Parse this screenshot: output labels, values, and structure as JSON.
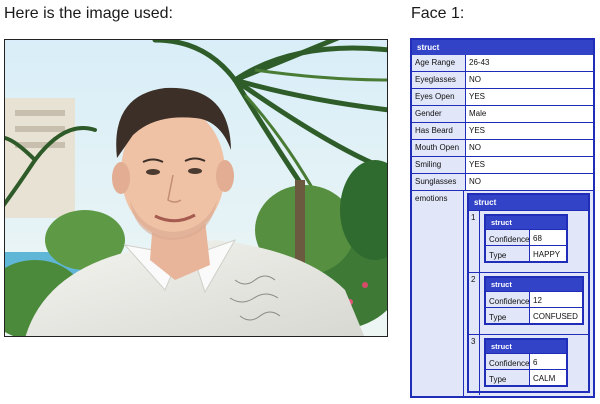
{
  "headings": {
    "left": "Here is the image used:",
    "right": "Face 1:"
  },
  "face": {
    "struct_label": "struct",
    "rows": [
      {
        "key": "Age Range",
        "value": "26-43"
      },
      {
        "key": "Eyeglasses",
        "value": "NO"
      },
      {
        "key": "Eyes Open",
        "value": "YES"
      },
      {
        "key": "Gender",
        "value": "Male"
      },
      {
        "key": "Has Beard",
        "value": "YES"
      },
      {
        "key": "Mouth Open",
        "value": "NO"
      },
      {
        "key": "Smiling",
        "value": "YES"
      },
      {
        "key": "Sunglasses",
        "value": "NO"
      }
    ],
    "emotions_key": "emotions",
    "emotions": [
      {
        "index": "1",
        "label": "struct",
        "confidence_key": "Confidence",
        "confidence": "68",
        "type_key": "Type",
        "type": "HAPPY"
      },
      {
        "index": "2",
        "label": "struct",
        "confidence_key": "Confidence",
        "confidence": "12",
        "type_key": "Type",
        "type": "CONFUSED"
      },
      {
        "index": "3",
        "label": "struct",
        "confidence_key": "Confidence",
        "confidence": "6",
        "type_key": "Type",
        "type": "CALM"
      }
    ]
  },
  "colors": {
    "border": "#1f2db8",
    "header": "#3243c8",
    "key_bg": "#e1e6f8"
  }
}
